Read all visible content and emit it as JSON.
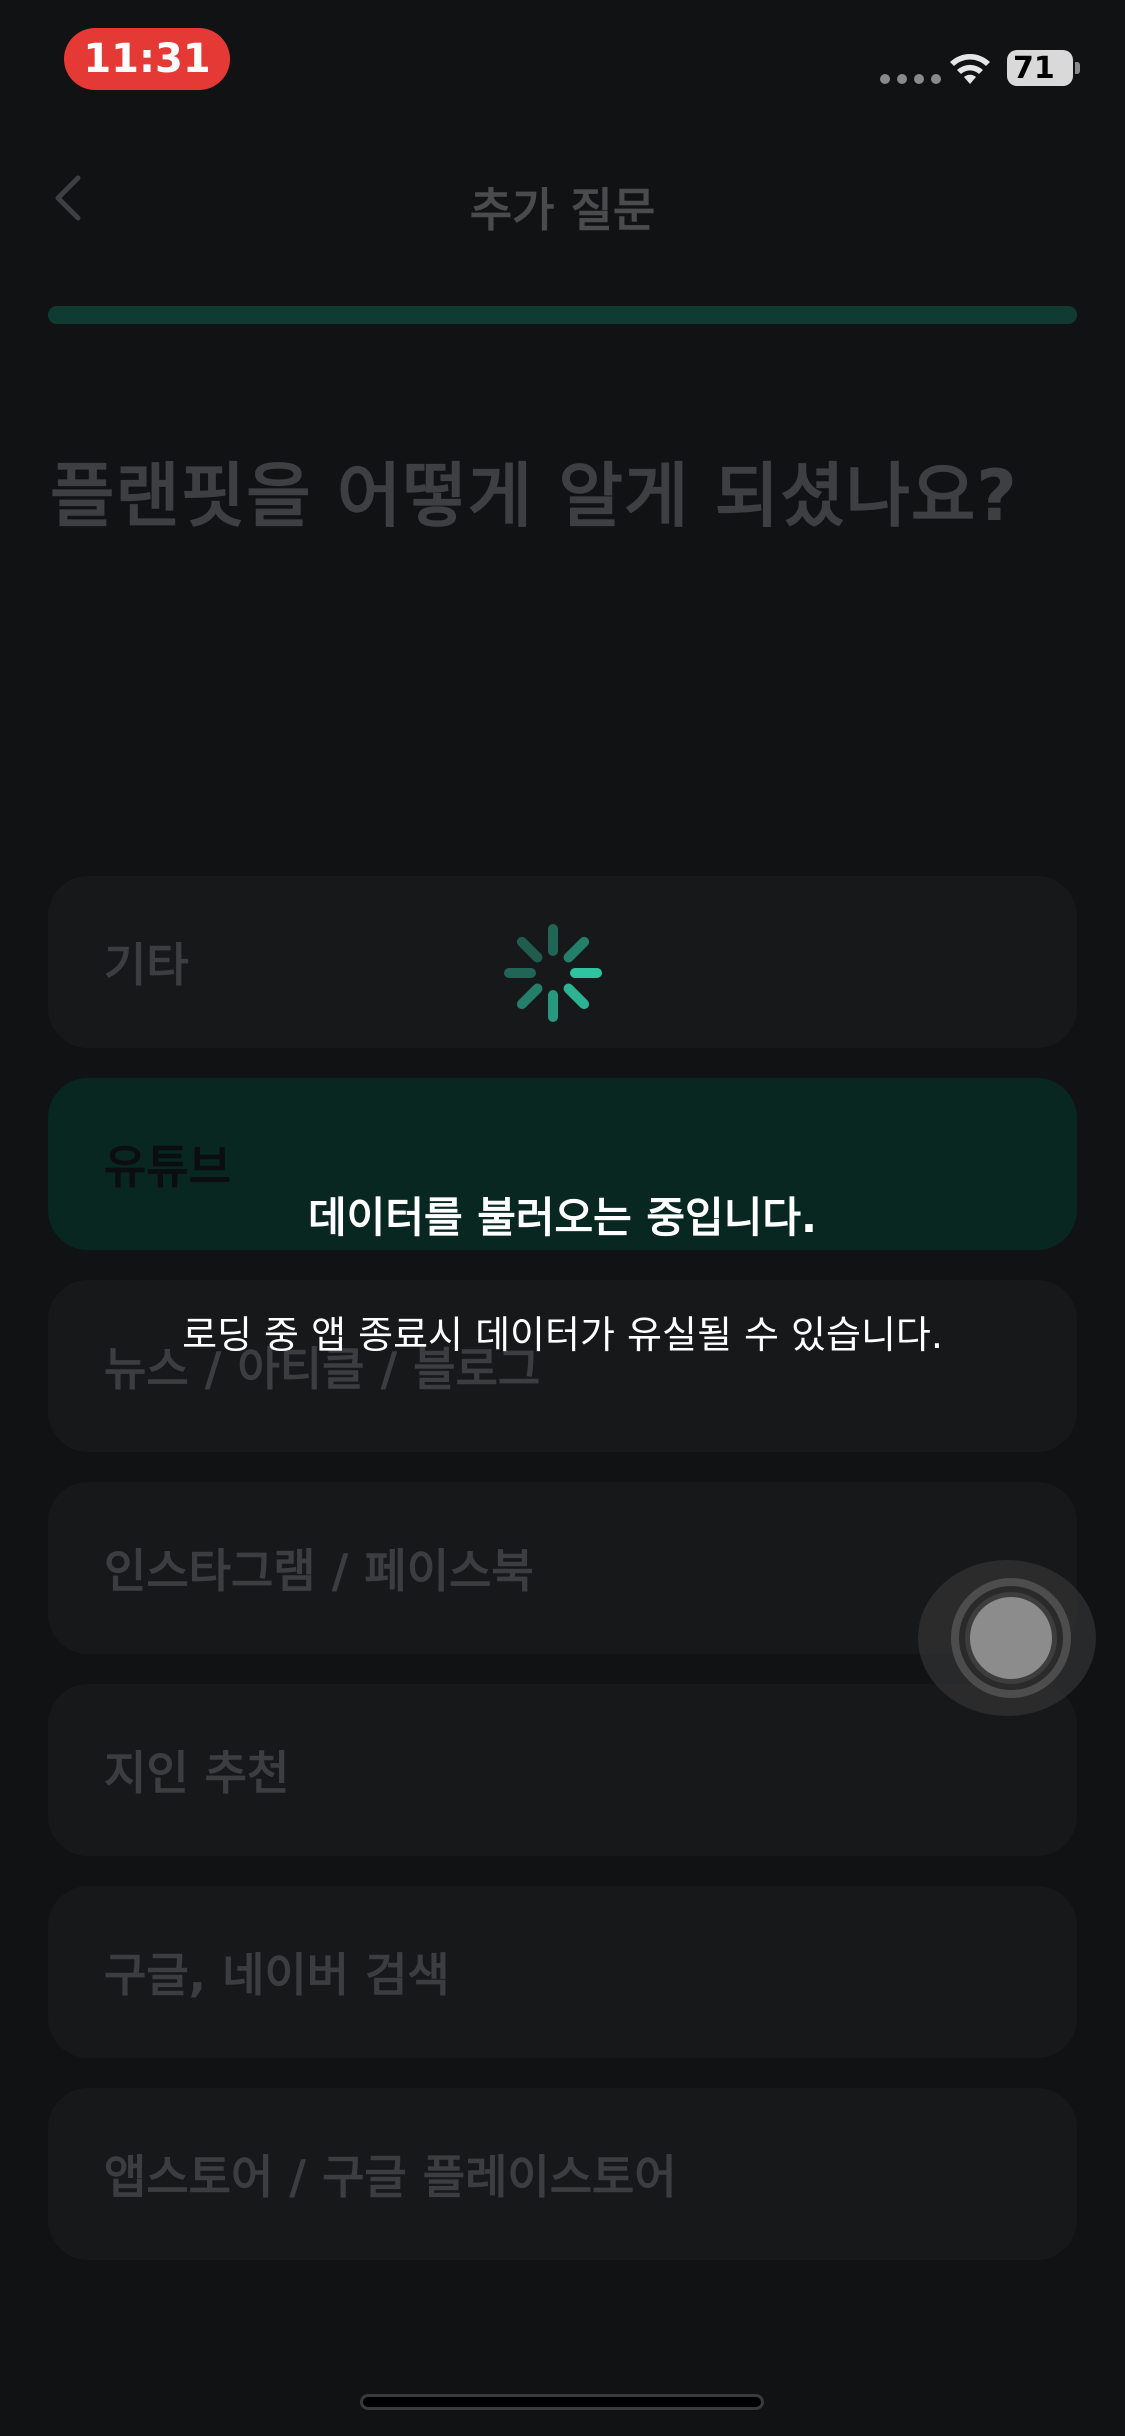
{
  "status_bar": {
    "time": "11:31",
    "battery": "71",
    "icons": [
      "signal-dots-icon",
      "wifi-icon",
      "battery-icon"
    ]
  },
  "nav": {
    "title": "추가 질문",
    "back_icon": "chevron-left-icon"
  },
  "progress": {
    "value_percent": 100,
    "color": "#0f3b33"
  },
  "question": "플랜핏을 어떻게 알게 되셨나요?",
  "options": [
    {
      "label": "기타",
      "selected": false
    },
    {
      "label": "유튜브",
      "selected": true
    },
    {
      "label": "뉴스 / 아티클 / 블로그",
      "selected": false
    },
    {
      "label": "인스타그램 / 페이스북",
      "selected": false
    },
    {
      "label": "지인 추천",
      "selected": false
    },
    {
      "label": "구글, 네이버 검색",
      "selected": false
    },
    {
      "label": "앱스토어 / 구글 플레이스토어",
      "selected": false
    }
  ],
  "loading": {
    "title": "데이터를 불러오는 중입니다.",
    "subtitle": "로딩 중 앱 종료시 데이터가 유실될 수 있습니다.",
    "spinner_color": "#2ec4a0"
  },
  "colors": {
    "accent": "#2ec4a0",
    "selected_bg": "#072720",
    "time_pill": "#e53935"
  }
}
